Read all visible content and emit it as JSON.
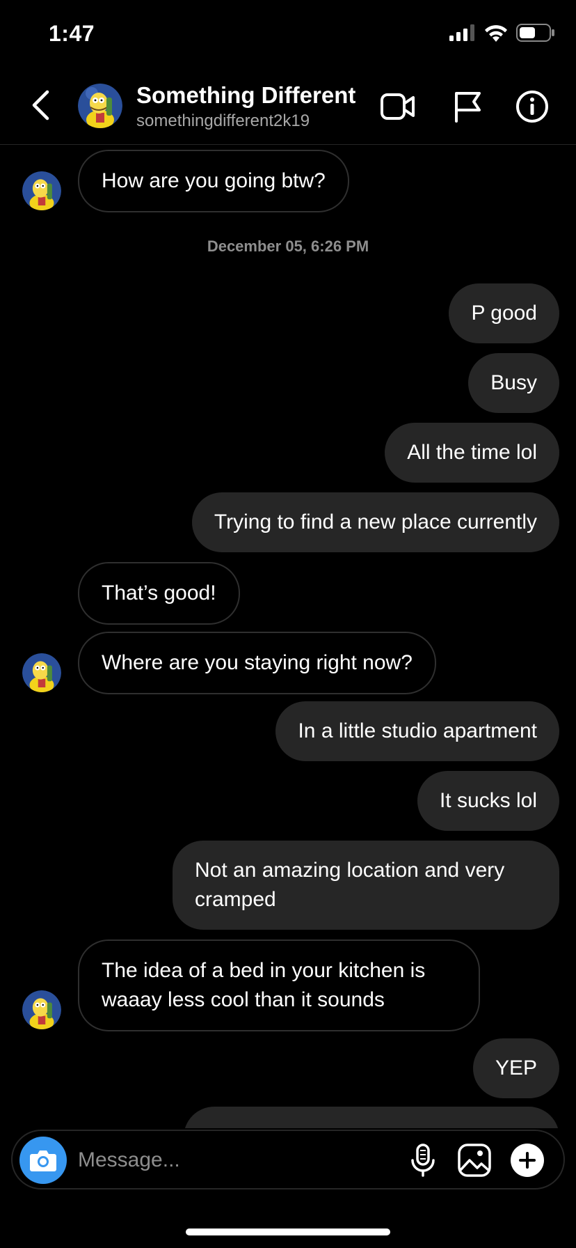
{
  "status_bar": {
    "time": "1:47",
    "icons": [
      "signal-icon",
      "wifi-icon",
      "battery-icon"
    ],
    "battery_level": 0.55
  },
  "header": {
    "name": "Something Different",
    "username": "somethingdifferent2k19",
    "icons": [
      "back-icon",
      "video-call-icon",
      "flag-icon",
      "info-icon"
    ]
  },
  "thread": {
    "messages": [
      {
        "from": "them",
        "text": "How are you going btw?"
      },
      {
        "type": "timestamp",
        "text": "December 05, 6:26 PM"
      },
      {
        "from": "me",
        "text": "P good"
      },
      {
        "from": "me",
        "text": "Busy"
      },
      {
        "from": "me",
        "text": "All the time lol"
      },
      {
        "from": "me",
        "text": "Trying to find a new place currently"
      },
      {
        "from": "them",
        "text": "That’s good!"
      },
      {
        "from": "them",
        "text": "Where are you staying right now?"
      },
      {
        "from": "me",
        "text": "In a little studio apartment"
      },
      {
        "from": "me",
        "text": "It sucks lol"
      },
      {
        "from": "me",
        "text": "Not an amazing location and very cramped"
      },
      {
        "from": "them",
        "text": "The idea of a bed in your kitchen is waaay less cool than it sounds"
      },
      {
        "from": "me",
        "text": "YEP"
      }
    ]
  },
  "composer": {
    "placeholder": "Message...",
    "icons": [
      "camera-icon",
      "microphone-icon",
      "gallery-icon",
      "plus-icon"
    ]
  },
  "colors": {
    "background": "#000000",
    "outgoing_bubble": "#262626",
    "incoming_border": "#2f2f2f",
    "camera_button": "#3797f0",
    "secondary_text": "#a8a8a8"
  }
}
